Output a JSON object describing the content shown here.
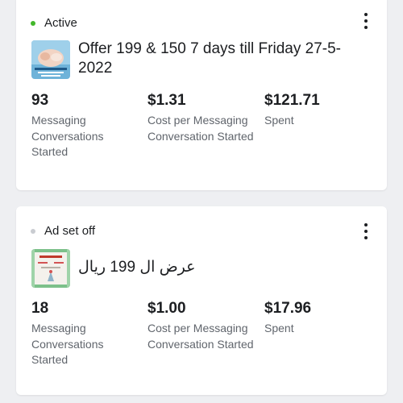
{
  "colors": {
    "active_dot": "#42b72a",
    "off_dot": "#c9ccd1"
  },
  "icons": {
    "more": "more-vertical-icon",
    "status": "status-dot-icon"
  },
  "cards": [
    {
      "status": "Active",
      "ad_name": "Offer 199 & 150 7 days till Friday 27-5-2022",
      "metrics": [
        {
          "value": "93",
          "label": "Messaging Conversations Started"
        },
        {
          "value": "$1.31",
          "label": "Cost per Messaging Conversation Started"
        },
        {
          "value": "$121.71",
          "label": "Spent"
        }
      ]
    },
    {
      "status": "Ad set off",
      "ad_name": "عرض ال 199 ريال",
      "metrics": [
        {
          "value": "18",
          "label": "Messaging Conversations Started"
        },
        {
          "value": "$1.00",
          "label": "Cost per Messaging Conversation Started"
        },
        {
          "value": "$17.96",
          "label": "Spent"
        }
      ]
    }
  ]
}
